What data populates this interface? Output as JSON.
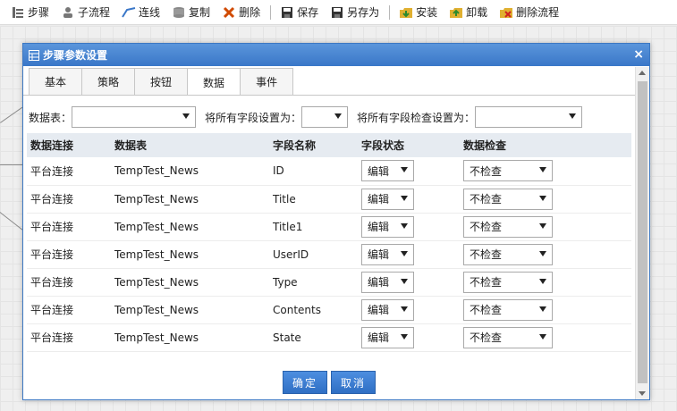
{
  "toolbar": {
    "items": [
      {
        "label": "步骤",
        "icon": "steps-icon"
      },
      {
        "label": "子流程",
        "icon": "subflow-icon"
      },
      {
        "label": "连线",
        "icon": "connect-line-icon"
      },
      {
        "label": "复制",
        "icon": "copy-icon"
      },
      {
        "label": "删除",
        "icon": "delete-icon"
      },
      {
        "label": "保存",
        "icon": "save-icon"
      },
      {
        "label": "另存为",
        "icon": "save-as-icon"
      },
      {
        "label": "安装",
        "icon": "install-icon"
      },
      {
        "label": "卸载",
        "icon": "uninstall-icon"
      },
      {
        "label": "删除流程",
        "icon": "delete-flow-icon"
      }
    ]
  },
  "dialog": {
    "title": "步骤参数设置",
    "close_label": "×",
    "tabs": [
      "基本",
      "策略",
      "按钮",
      "数据",
      "事件"
    ],
    "active_tab": "数据",
    "filters": {
      "table_label": "数据表：",
      "table_value": "",
      "field_setting_label": "将所有字段设置为：",
      "field_setting_value": "",
      "check_setting_label": "将所有字段检查设置为：",
      "check_setting_value": ""
    },
    "columns": [
      "数据连接",
      "数据表",
      "字段名称",
      "字段状态",
      "数据检查"
    ],
    "rows": [
      {
        "connection": "平台连接",
        "table": "TempTest_News",
        "field": "ID",
        "status": "编辑",
        "check": "不检查"
      },
      {
        "connection": "平台连接",
        "table": "TempTest_News",
        "field": "Title",
        "status": "编辑",
        "check": "不检查"
      },
      {
        "connection": "平台连接",
        "table": "TempTest_News",
        "field": "Title1",
        "status": "编辑",
        "check": "不检查"
      },
      {
        "connection": "平台连接",
        "table": "TempTest_News",
        "field": "UserID",
        "status": "编辑",
        "check": "不检查"
      },
      {
        "connection": "平台连接",
        "table": "TempTest_News",
        "field": "Type",
        "status": "编辑",
        "check": "不检查"
      },
      {
        "connection": "平台连接",
        "table": "TempTest_News",
        "field": "Contents",
        "status": "编辑",
        "check": "不检查"
      },
      {
        "connection": "平台连接",
        "table": "TempTest_News",
        "field": "State",
        "status": "编辑",
        "check": "不检查"
      }
    ],
    "confirm_label": "确定",
    "cancel_label": "取消"
  },
  "colors": {
    "title_bar": "#3a77c8",
    "button": "#2f6fc4",
    "header_bg": "#e6ebf1"
  }
}
